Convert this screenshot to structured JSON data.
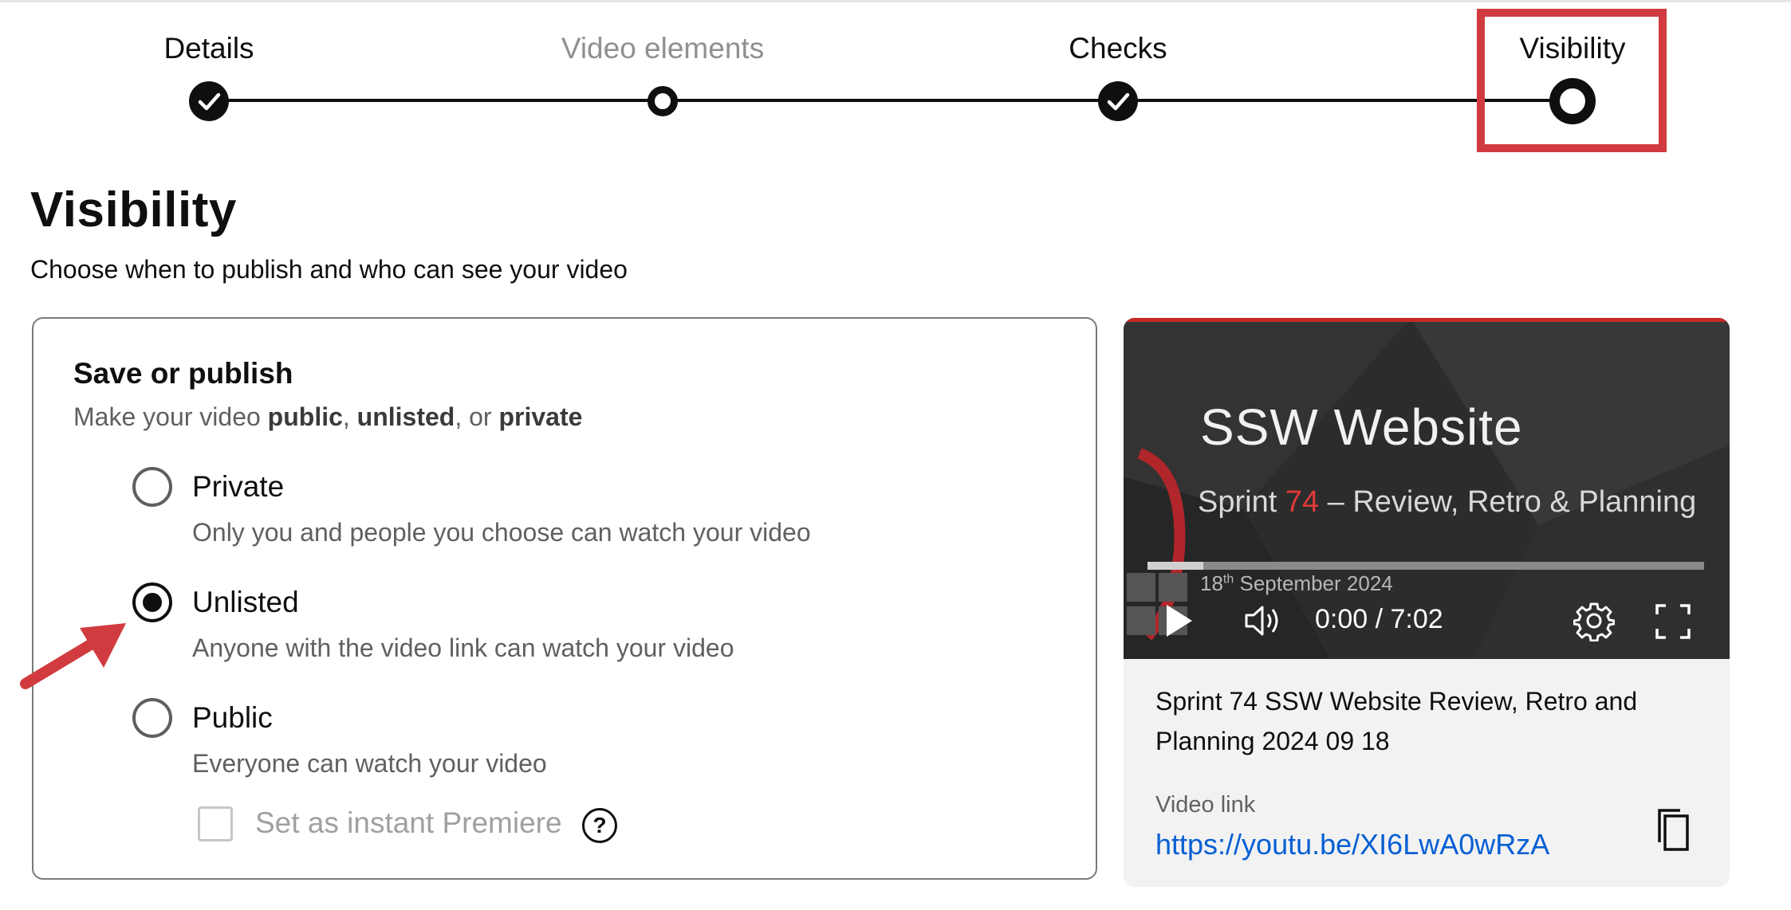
{
  "stepper": {
    "steps": [
      {
        "label": "Details",
        "state": "complete"
      },
      {
        "label": "Video elements",
        "state": "incomplete"
      },
      {
        "label": "Checks",
        "state": "complete"
      },
      {
        "label": "Visibility",
        "state": "current"
      }
    ]
  },
  "page": {
    "title": "Visibility",
    "subtitle": "Choose when to publish and who can see your video"
  },
  "save_publish": {
    "title": "Save or publish",
    "subtitle_prefix": "Make your video ",
    "subtitle_public": "public",
    "subtitle_sep1": ", ",
    "subtitle_unlisted": "unlisted",
    "subtitle_sep2": ", or ",
    "subtitle_private": "private",
    "options": [
      {
        "label": "Private",
        "description": "Only you and people you choose can watch your video",
        "selected": false
      },
      {
        "label": "Unlisted",
        "description": "Anyone with the video link can watch your video",
        "selected": true
      },
      {
        "label": "Public",
        "description": "Everyone can watch your video",
        "selected": false
      }
    ],
    "premiere_label": "Set as instant Premiere",
    "help_symbol": "?"
  },
  "video": {
    "thumb_title": "SSW Website",
    "thumb_sub_prefix": "Sprint ",
    "thumb_sub_number": "74",
    "thumb_sub_rest": " – Review, Retro & Planning",
    "thumb_date_day": "18",
    "thumb_date_suffix": "th",
    "thumb_date_rest": " September 2024",
    "time": "0:00 / 7:02",
    "title": "Sprint 74 SSW Website Review, Retro and Planning 2024 09 18",
    "link_label": "Video link",
    "link_url": "https://youtu.be/XI6LwA0wRzA",
    "icons": [
      "play-icon",
      "volume-icon",
      "settings-gear-icon",
      "fullscreen-icon",
      "copy-icon"
    ]
  },
  "colors": {
    "highlight": "#d13b3f",
    "link": "#065fd4",
    "accent_red": "#c62828"
  }
}
